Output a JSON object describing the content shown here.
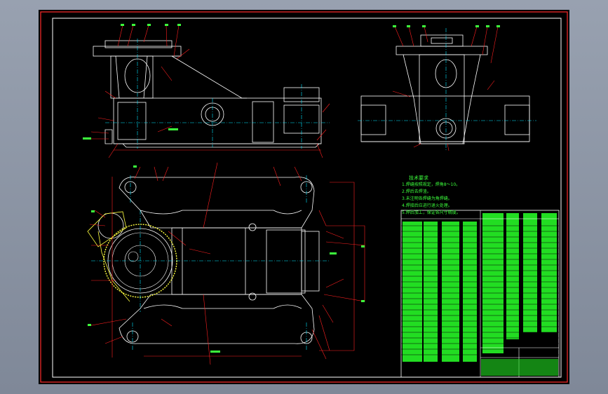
{
  "drawing": {
    "notes_title": "技术要求",
    "notes": [
      "1.焊缝按照规定，焊角8～10。",
      "2.焊后去焊渣。",
      "3.未注明各焊缝为角焊缝。",
      "4.焊接后应进行退火处理。",
      "5.焊后加工，保证各尺寸精度。"
    ]
  },
  "colors": {
    "background": "#000000",
    "frame": "#ffffff",
    "border_red": "#ff0000",
    "leader_red": "#ff2020",
    "geometry": "#ffffff",
    "centerline": "#00e5ff",
    "annotation": "#3cff3c",
    "hatch": "#ffff40"
  }
}
